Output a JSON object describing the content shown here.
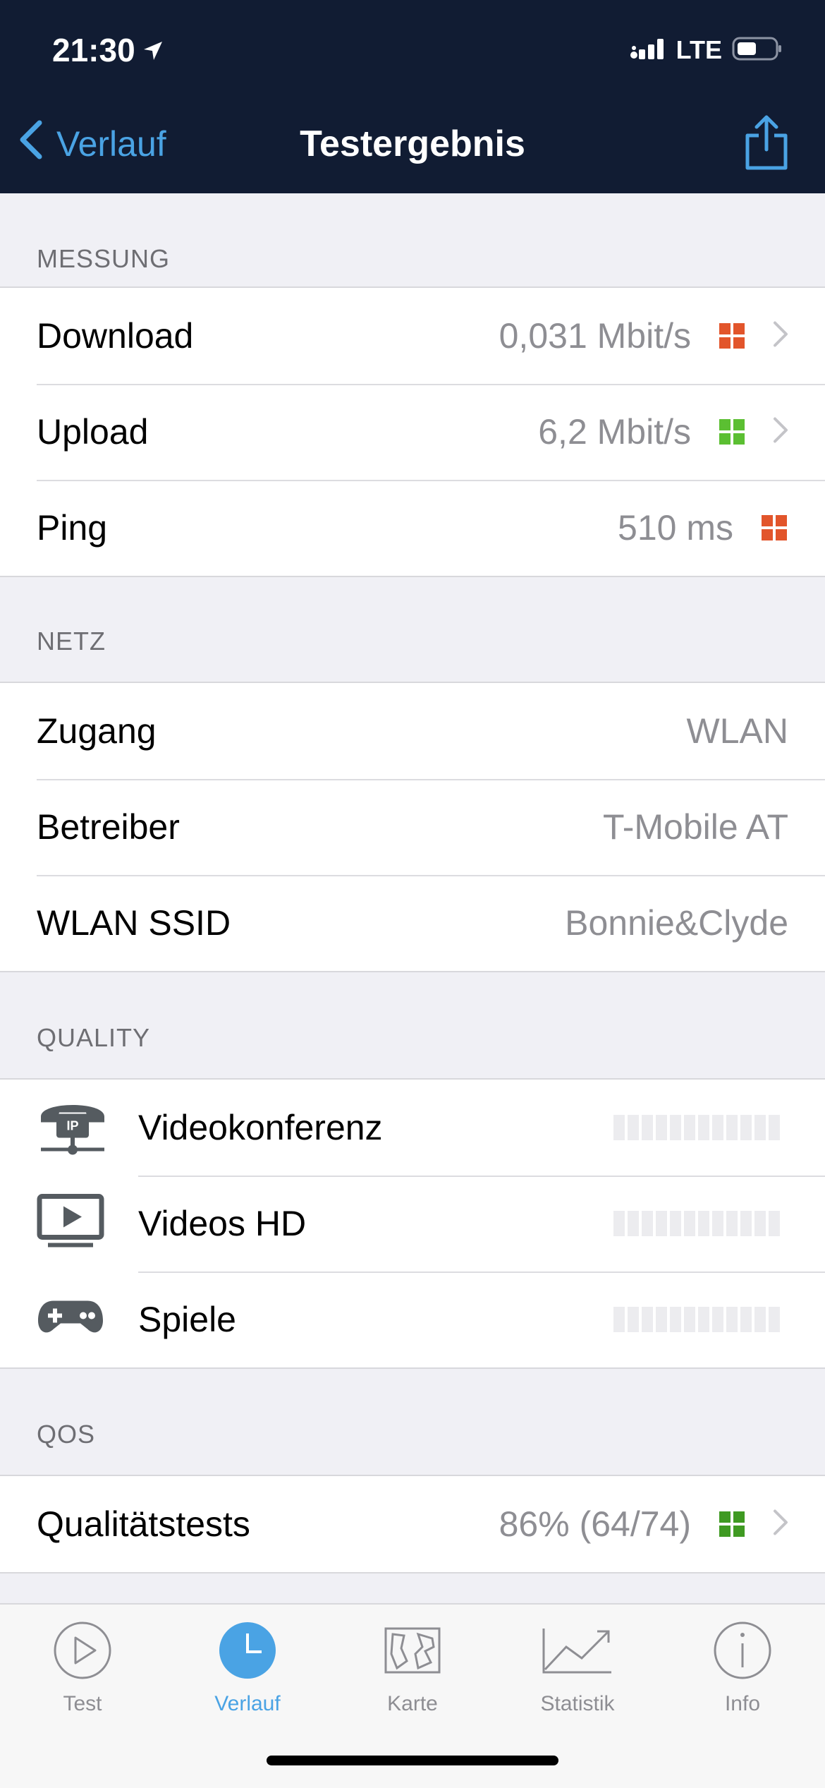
{
  "status": {
    "time": "21:30",
    "network": "LTE"
  },
  "nav": {
    "back_label": "Verlauf",
    "title": "Testergebnis"
  },
  "sections": {
    "measurement": {
      "title": "MESSUNG",
      "rows": [
        {
          "label": "Download",
          "value": "0,031 Mbit/s",
          "rating": "red"
        },
        {
          "label": "Upload",
          "value": "6,2 Mbit/s",
          "rating": "green"
        },
        {
          "label": "Ping",
          "value": "510 ms",
          "rating": "red"
        }
      ]
    },
    "network": {
      "title": "NETZ",
      "rows": [
        {
          "label": "Zugang",
          "value": "WLAN"
        },
        {
          "label": "Betreiber",
          "value": "T-Mobile AT"
        },
        {
          "label": "WLAN SSID",
          "value": "Bonnie&Clyde"
        }
      ]
    },
    "quality": {
      "title": "QUALITY",
      "rows": [
        {
          "label": "Videokonferenz",
          "icon": "ip-phone-icon"
        },
        {
          "label": "Videos HD",
          "icon": "tv-play-icon"
        },
        {
          "label": "Spiele",
          "icon": "gamepad-icon"
        }
      ]
    },
    "qos": {
      "title": "QOS",
      "rows": [
        {
          "label": "Qualitätstests",
          "value": "86% (64/74)",
          "rating": "green"
        }
      ]
    }
  },
  "tabs": [
    {
      "label": "Test",
      "icon": "play-circle-icon",
      "active": false
    },
    {
      "label": "Verlauf",
      "icon": "clock-icon",
      "active": true
    },
    {
      "label": "Karte",
      "icon": "map-icon",
      "active": false
    },
    {
      "label": "Statistik",
      "icon": "chart-icon",
      "active": false
    },
    {
      "label": "Info",
      "icon": "info-icon",
      "active": false
    }
  ],
  "colors": {
    "header_bg": "#111c33",
    "accent": "#4aa3e4",
    "rating_red": "#e2552b",
    "rating_green": "#5bbf32"
  }
}
